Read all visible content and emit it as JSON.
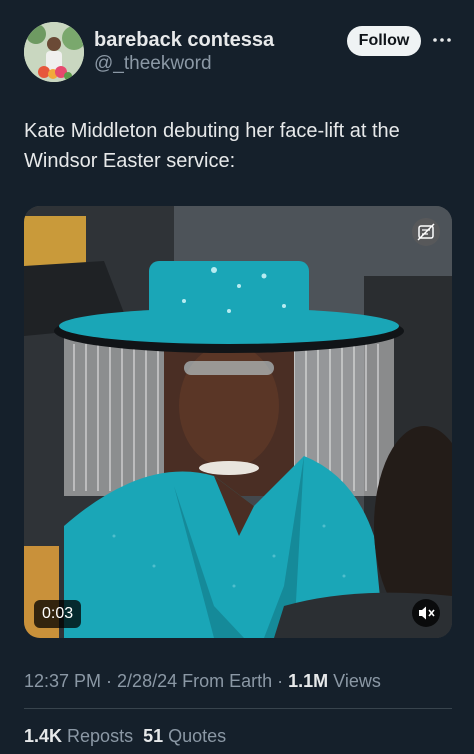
{
  "author": {
    "display_name": "bareback contessa",
    "handle": "@_theekword"
  },
  "actions": {
    "follow_label": "Follow"
  },
  "icons": {
    "more": "more-horizontal-icon",
    "caption": "captions-icon",
    "mute": "volume-muted-icon"
  },
  "tweet": {
    "text": "Kate Middleton debuting her face-lift at the Windsor Easter service:"
  },
  "video": {
    "elapsed": "0:03"
  },
  "meta": {
    "time": "12:37 PM",
    "sep1": " · ",
    "date": "2/28/24",
    "source": " From Earth",
    "sep2": " · ",
    "views_count": "1.1M",
    "views_label": " Views"
  },
  "stats": {
    "reposts_count": "1.4K",
    "reposts_label": " Reposts",
    "quotes_count": "51",
    "quotes_label": " Quotes"
  },
  "colors": {
    "background": "#15202b",
    "text_primary": "#e7e9ea",
    "text_secondary": "#8b98a5",
    "follow_bg": "#eff3f4",
    "teal_outfit": "#1aa6b7"
  }
}
